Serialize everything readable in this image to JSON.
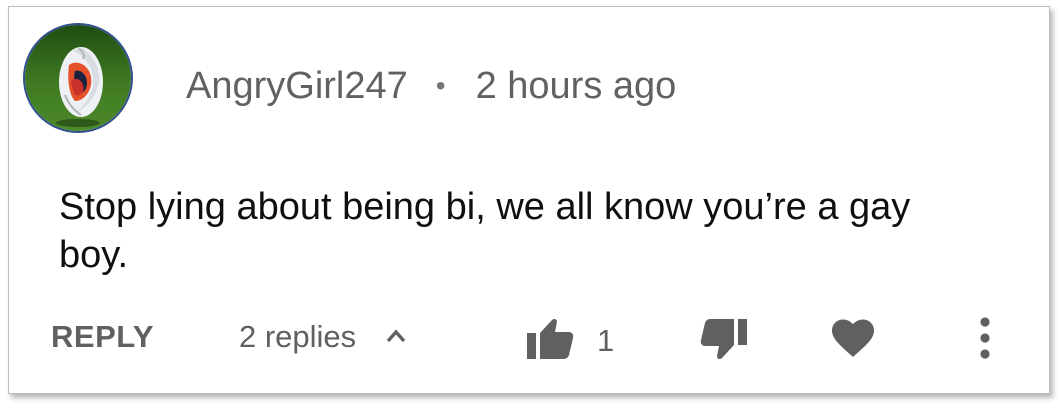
{
  "comment": {
    "author": "AngryGirl247",
    "separator": "•",
    "timestamp": "2 hours ago",
    "text": "Stop lying about being bi, we all know you’re a gay boy."
  },
  "actions": {
    "reply_label": "REPLY",
    "replies_label": "2 replies",
    "like_count": "1"
  },
  "icons": {
    "avatar": "soccer-ball-avatar",
    "replies_toggle": "chevron-up-icon",
    "like": "thumbs-up-icon",
    "dislike": "thumbs-down-icon",
    "heart": "heart-icon",
    "more": "more-vertical-icon"
  },
  "colors": {
    "icon": "#606060",
    "text": "#0f0f0f",
    "muted_text": "#616161"
  }
}
